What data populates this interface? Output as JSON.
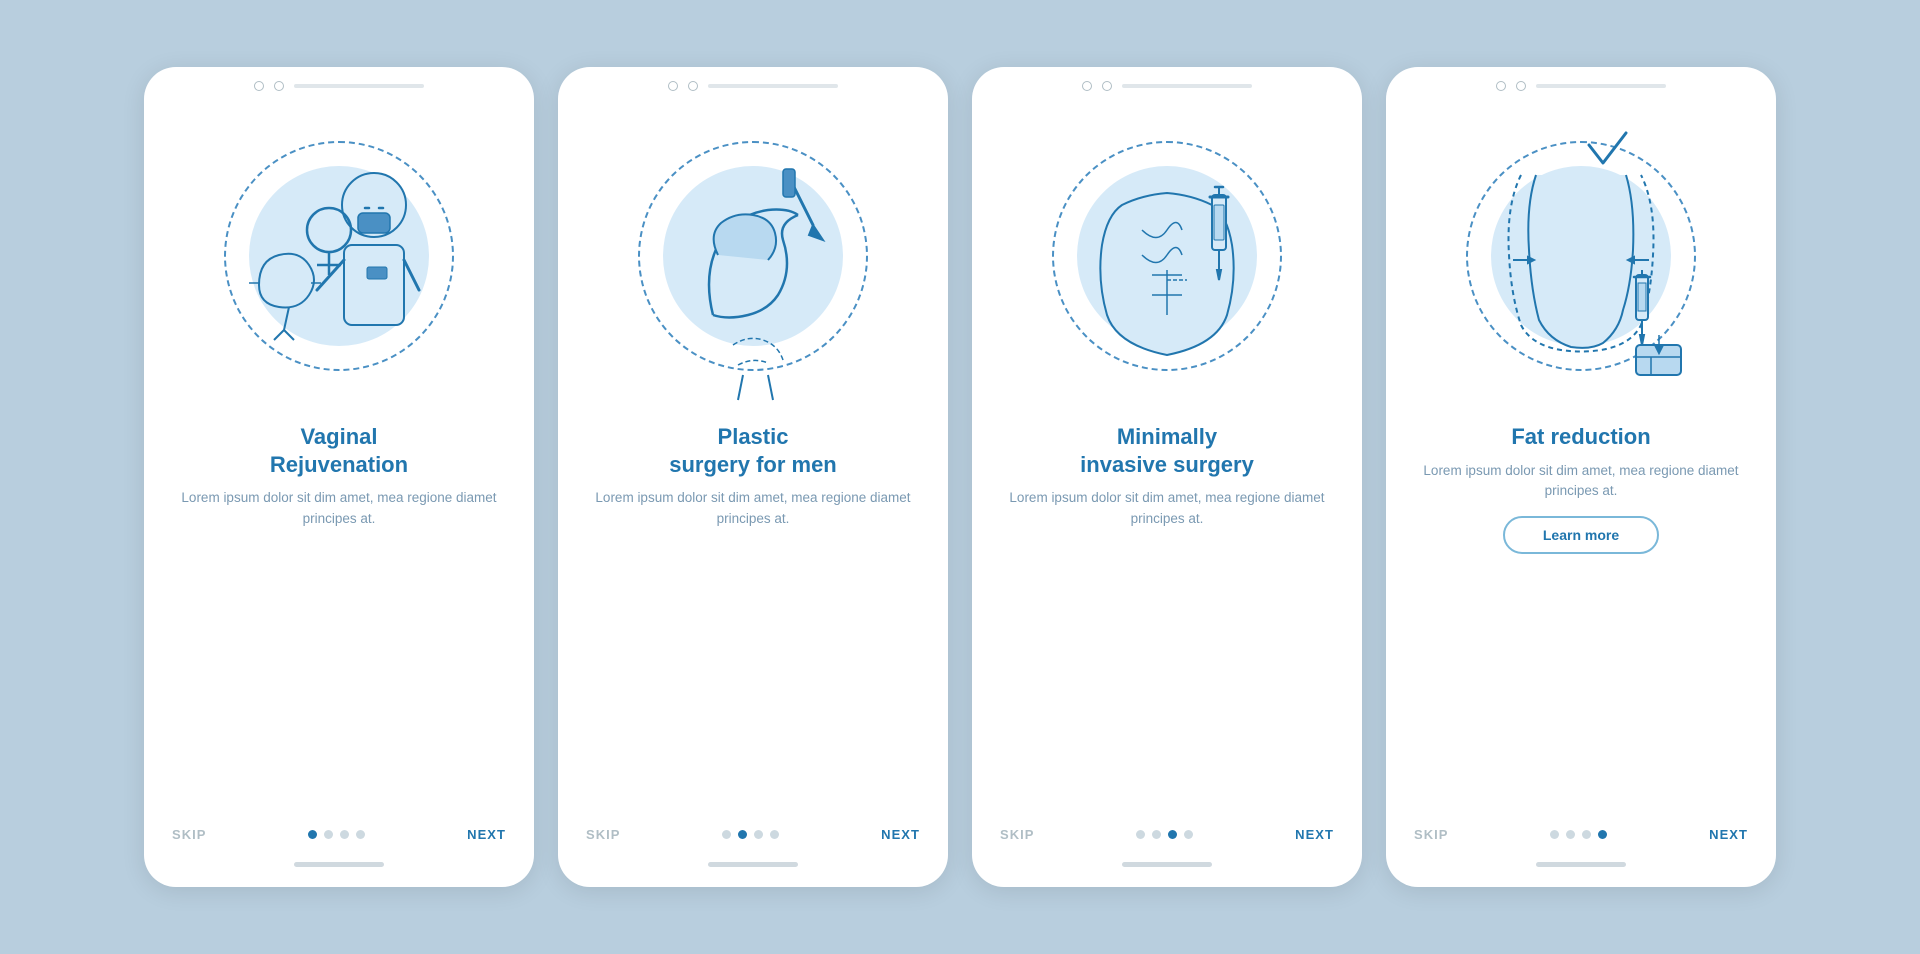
{
  "background_color": "#b8cede",
  "cards": [
    {
      "id": "card-1",
      "title": "Vaginal\nRejuvenation",
      "description": "Lorem ipsum dolor sit dim amet, mea regione diamet principes at.",
      "show_learn_more": false,
      "dots": [
        true,
        false,
        false,
        false
      ],
      "skip_label": "SKIP",
      "next_label": "NEXT"
    },
    {
      "id": "card-2",
      "title": "Plastic\nsurgery for men",
      "description": "Lorem ipsum dolor sit dim amet, mea regione diamet principes at.",
      "show_learn_more": false,
      "dots": [
        false,
        true,
        false,
        false
      ],
      "skip_label": "SKIP",
      "next_label": "NEXT"
    },
    {
      "id": "card-3",
      "title": "Minimally\ninvasive surgery",
      "description": "Lorem ipsum dolor sit dim amet, mea regione diamet principes at.",
      "show_learn_more": false,
      "dots": [
        false,
        false,
        true,
        false
      ],
      "skip_label": "SKIP",
      "next_label": "NEXT"
    },
    {
      "id": "card-4",
      "title": "Fat reduction",
      "description": "Lorem ipsum dolor sit dim amet, mea regione diamet principes at.",
      "show_learn_more": true,
      "learn_more_label": "Learn more",
      "dots": [
        false,
        false,
        false,
        true
      ],
      "skip_label": "SKIP",
      "next_label": "NEXT"
    }
  ]
}
